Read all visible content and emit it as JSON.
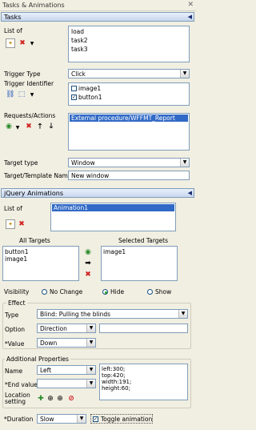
{
  "window": {
    "title": "Tasks & Animations",
    "close_icon": "x"
  },
  "tasks_section": {
    "title": "Tasks"
  },
  "list_of": {
    "label": "List of",
    "items": [
      "load",
      "task2",
      "task3"
    ]
  },
  "trigger_type": {
    "label": "Trigger Type",
    "value": "Click"
  },
  "trigger_identifier": {
    "label": "Trigger Identifier",
    "items": [
      {
        "label": "image1",
        "checked": false
      },
      {
        "label": "button1",
        "checked": true
      }
    ]
  },
  "requests_actions": {
    "label": "Requests/Actions",
    "selected_item": "External procedure/WFFMT_Report"
  },
  "target_type": {
    "label": "Target type",
    "value": "Window"
  },
  "target_template": {
    "label": "Target/Template Name",
    "value": "New window"
  },
  "jquery_section": {
    "title": "jQuery Animations"
  },
  "anim_list": {
    "label": "List of",
    "selected_item": "Animation1"
  },
  "all_targets": {
    "label": "All Targets",
    "items": [
      "button1",
      "image1"
    ]
  },
  "selected_targets": {
    "label": "Selected Targets",
    "items": [
      "image1"
    ]
  },
  "visibility": {
    "label": "Visibility",
    "options": [
      "No Change",
      "Hide",
      "Show"
    ],
    "selected": "Hide"
  },
  "effect": {
    "label": "Effect",
    "type_label": "Type",
    "type_value": "Blind: Pulling the blinds",
    "option_label": "Option",
    "option_value": "Direction",
    "value_label": "*Value",
    "value_value": "Down"
  },
  "additional": {
    "label": "Additional Properties",
    "name_label": "Name",
    "name_value": "Left",
    "end_value_label": "*End value",
    "properties_text": "left:300;\ntop:420;\nwidth:191;\nheight:60;",
    "location_label": "Location\nsetting"
  },
  "duration": {
    "label": "*Duration",
    "value": "Slow"
  },
  "toggle_animation": {
    "label": "Toggle animation",
    "checked": true
  }
}
